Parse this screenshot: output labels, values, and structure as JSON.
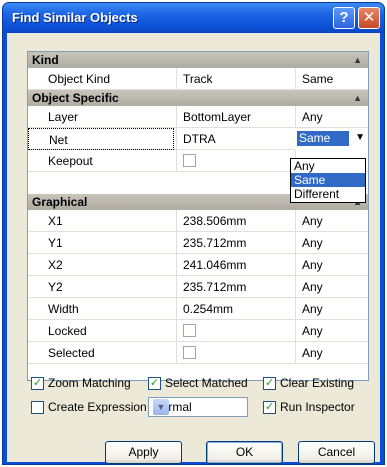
{
  "window": {
    "title": "Find Similar Objects"
  },
  "grid": {
    "sections": [
      {
        "label": "Kind"
      },
      {
        "label": "Object Specific"
      },
      {
        "label": "Graphical"
      }
    ],
    "rows": [
      {
        "name": "Object Kind",
        "value": "Track",
        "match": "Same"
      },
      {
        "name": "Layer",
        "value": "BottomLayer",
        "match": "Any"
      },
      {
        "name": "Net",
        "value": "DTRA",
        "match": "Same"
      },
      {
        "name": "Keepout",
        "value": "",
        "match": ""
      },
      {
        "name": "X1",
        "value": "238.506mm",
        "match": "Any"
      },
      {
        "name": "Y1",
        "value": "235.712mm",
        "match": "Any"
      },
      {
        "name": "X2",
        "value": "241.046mm",
        "match": "Any"
      },
      {
        "name": "Y2",
        "value": "235.712mm",
        "match": "Any"
      },
      {
        "name": "Width",
        "value": "0.254mm",
        "match": "Any"
      },
      {
        "name": "Locked",
        "value": "",
        "match": "Any"
      },
      {
        "name": "Selected",
        "value": "",
        "match": "Any"
      }
    ],
    "dropdown_options": [
      "Any",
      "Same",
      "Different"
    ],
    "dropdown_highlighted": "Same"
  },
  "options": {
    "zoom_matching": {
      "label": "Zoom Matching",
      "checked": true
    },
    "select_matched": {
      "label": "Select Matched",
      "checked": true
    },
    "clear_existing": {
      "label": "Clear Existing",
      "checked": true
    },
    "create_expression": {
      "label": "Create Expression",
      "checked": false
    },
    "mask_mode": "Normal",
    "run_inspector": {
      "label": "Run Inspector",
      "checked": true
    }
  },
  "buttons": {
    "apply": "Apply",
    "ok": "OK",
    "cancel": "Cancel"
  },
  "colors": {
    "selection": "#316ac5",
    "titlebar": "#0d52d8",
    "check": "#21a121"
  }
}
